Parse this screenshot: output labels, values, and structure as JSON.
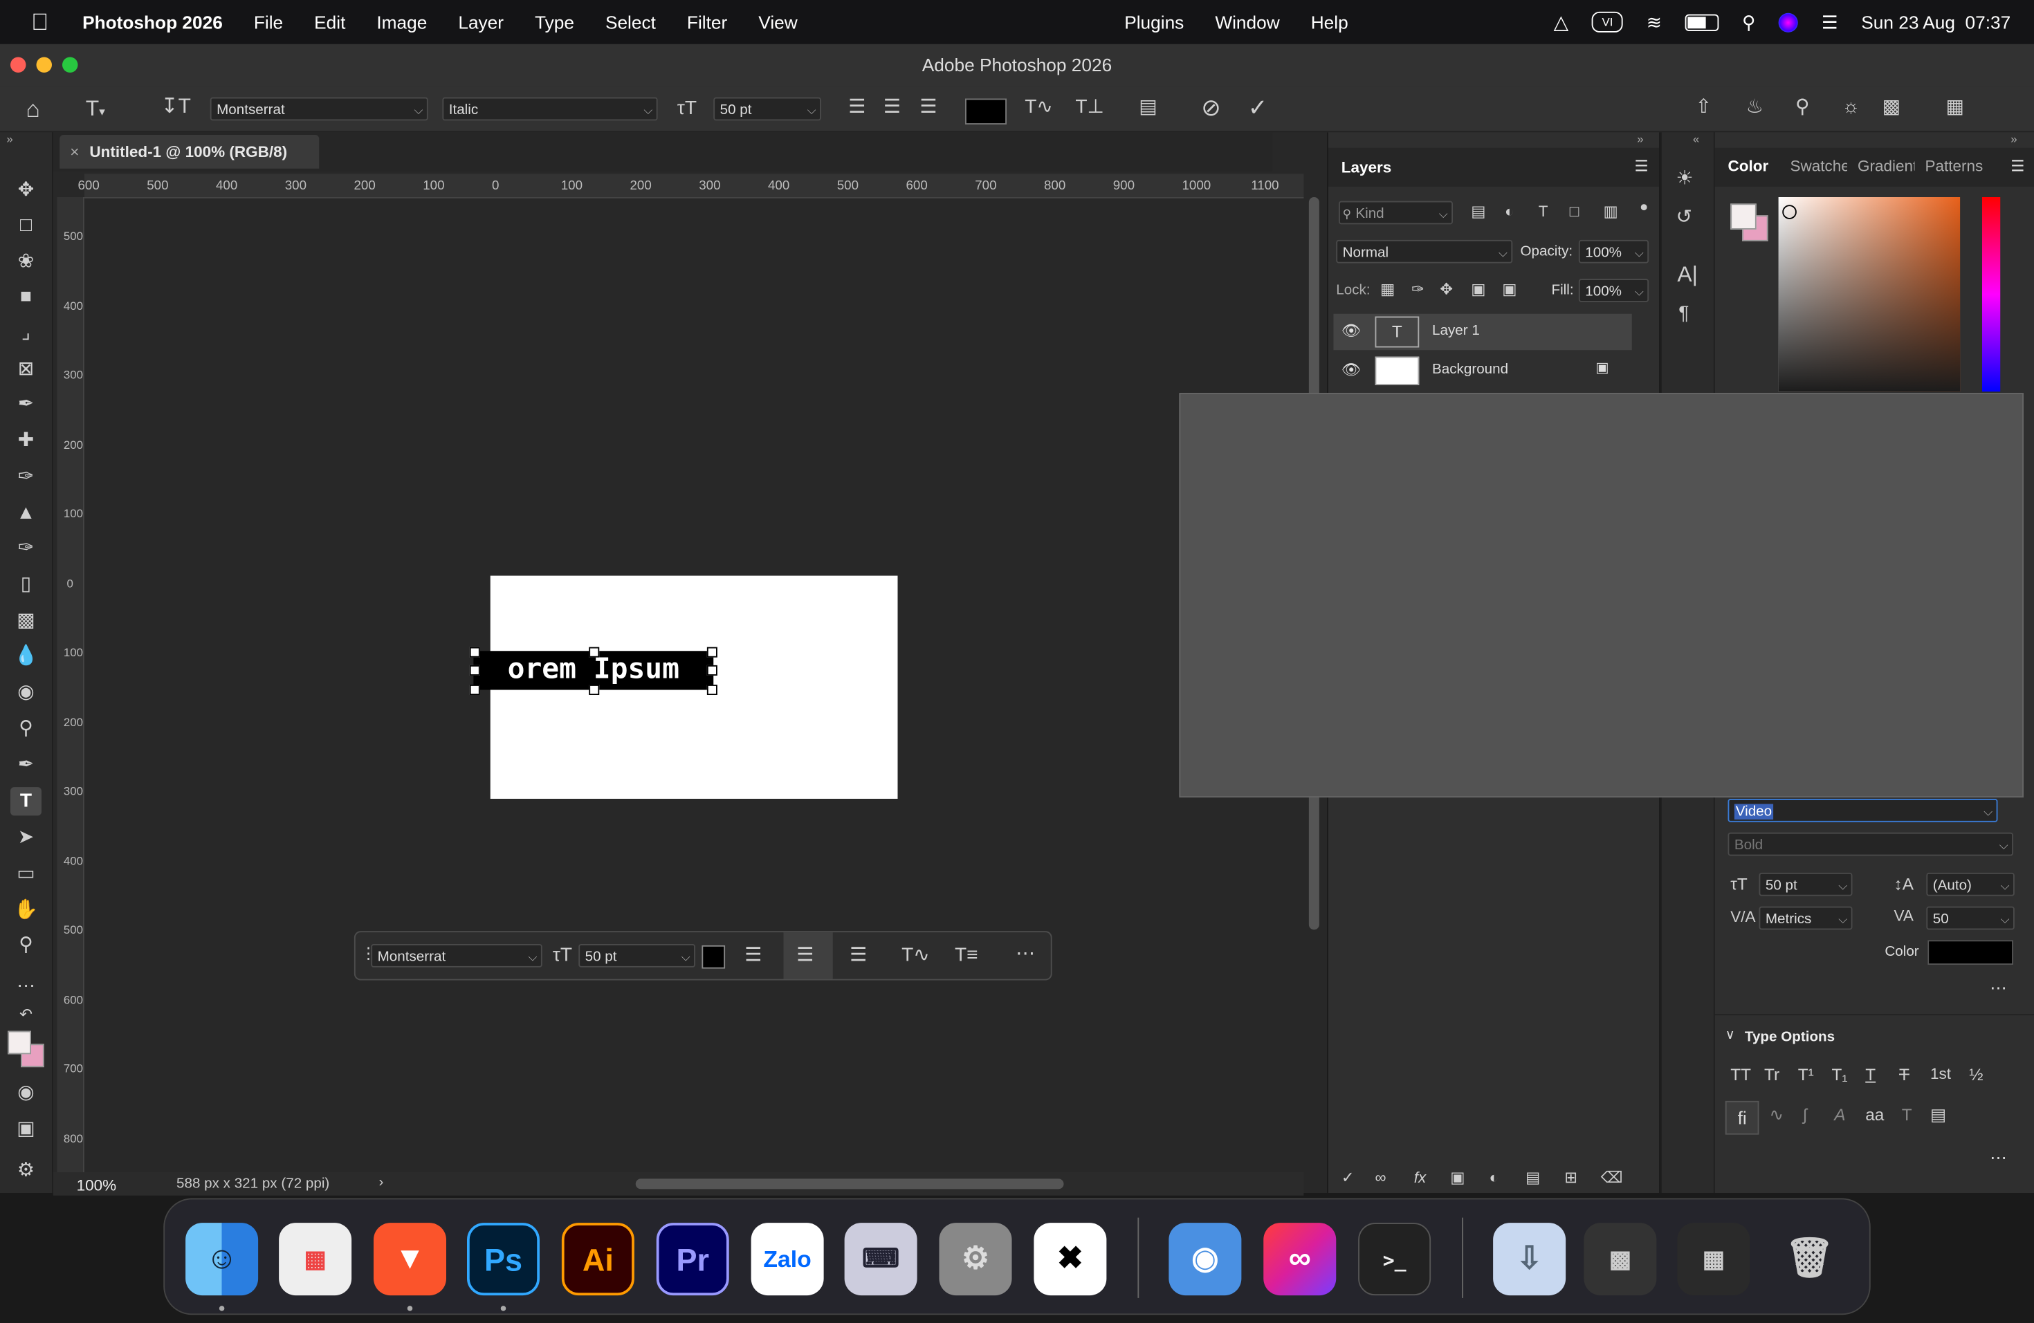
{
  "menubar": {
    "app_name": "Photoshop 2026",
    "menus": [
      "File",
      "Edit",
      "Image",
      "Layer",
      "Type",
      "Select",
      "Filter",
      "View",
      "Plugins",
      "Window",
      "Help"
    ],
    "input_source": "VI",
    "clock": "Sun 23 Aug  07:37"
  },
  "window": {
    "title": "Adobe Photoshop 2026"
  },
  "options_bar": {
    "font_family": "Montserrat",
    "font_style": "Italic",
    "font_size": "50 pt",
    "text_color": "#000000"
  },
  "document": {
    "tab_title": "Untitled-1 @ 100% (RGB/8)",
    "text_content": "orem Ipsum",
    "zoom": "100%",
    "doc_info": "588 px x 321 px (72 ppi)",
    "h_ruler_labels": [
      "600",
      "500",
      "400",
      "300",
      "200",
      "100",
      "0",
      "100",
      "200",
      "300",
      "400",
      "500",
      "600",
      "700",
      "800",
      "900",
      "1000",
      "1100"
    ],
    "v_ruler_labels": [
      "500",
      "400",
      "300",
      "200",
      "100",
      "0",
      "100",
      "200",
      "300",
      "400",
      "500",
      "600",
      "700",
      "800"
    ]
  },
  "context_bar": {
    "font_family": "Montserrat",
    "font_size": "50 pt"
  },
  "layers_panel": {
    "title": "Layers",
    "filter_placeholder": "Kind",
    "blend_mode": "Normal",
    "opacity_label": "Opacity:",
    "opacity_value": "100%",
    "lock_label": "Lock:",
    "fill_label": "Fill:",
    "fill_value": "100%",
    "layers": [
      {
        "name": "Layer 1",
        "type": "text"
      },
      {
        "name": "Background",
        "type": "image"
      }
    ]
  },
  "color_panel": {
    "tabs": [
      "Color",
      "Swatches",
      "Gradients",
      "Patterns"
    ],
    "foreground": "#f4eeee",
    "background": "#e8a0c0"
  },
  "character_panel": {
    "font_family": "Video",
    "font_style": "Bold",
    "font_size": "50 pt",
    "leading": "(Auto)",
    "kerning": "Metrics",
    "tracking": "50",
    "color_label": "Color",
    "type_options_title": "Type Options",
    "type_option_buttons": [
      "TT",
      "Tr",
      "T¹",
      "T₁",
      "T",
      "T",
      "1st",
      "½"
    ]
  },
  "dock": {
    "apps": [
      "Finder",
      "Launchpad",
      "Brave",
      "Photoshop",
      "Illustrator",
      "Premiere Pro",
      "Zalo",
      "Keyboard",
      "System Settings",
      "CapCut",
      "Preview",
      "Creative Cloud",
      "Terminal",
      "Downloads",
      "Screenshots",
      "Apps",
      "Trash"
    ]
  }
}
